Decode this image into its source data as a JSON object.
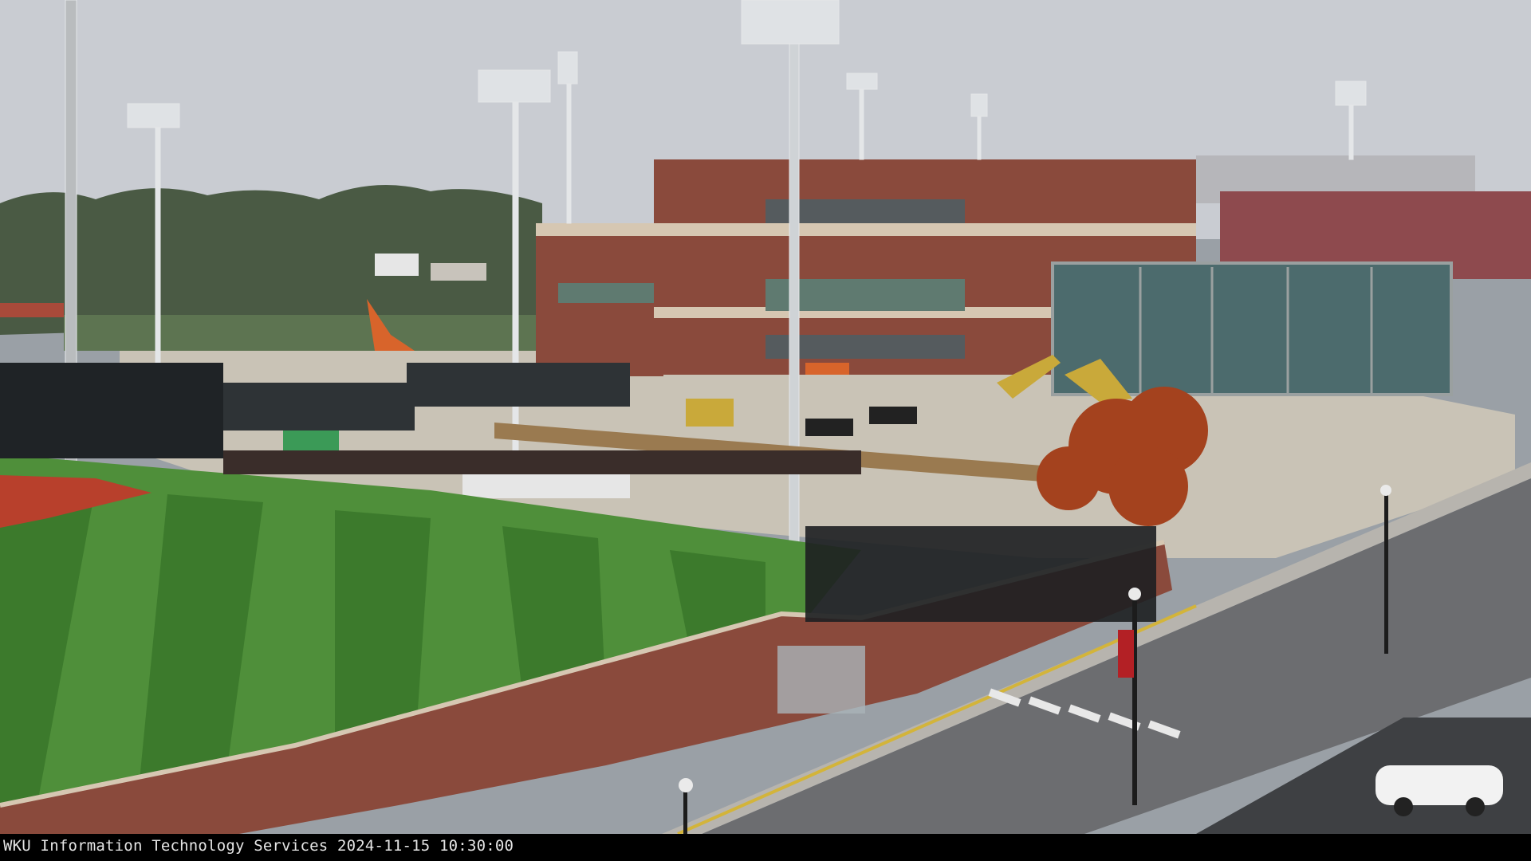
{
  "overlay": {
    "caption": "WKU Information Technology Services 2024-11-15 10:30:00"
  },
  "scene": {
    "description_icons": [
      "construction-site",
      "baseball-field",
      "stadium",
      "street"
    ],
    "colors": {
      "sky": "#c9ccd2",
      "brick": "#8a4a3c",
      "grass_light": "#4f8f3a",
      "grass_dark": "#3c7a2c",
      "infield_clay": "#b8402c",
      "gravel": "#c9c3b6",
      "road": "#6c6d70",
      "tree_autumn": "#a4421e"
    }
  }
}
